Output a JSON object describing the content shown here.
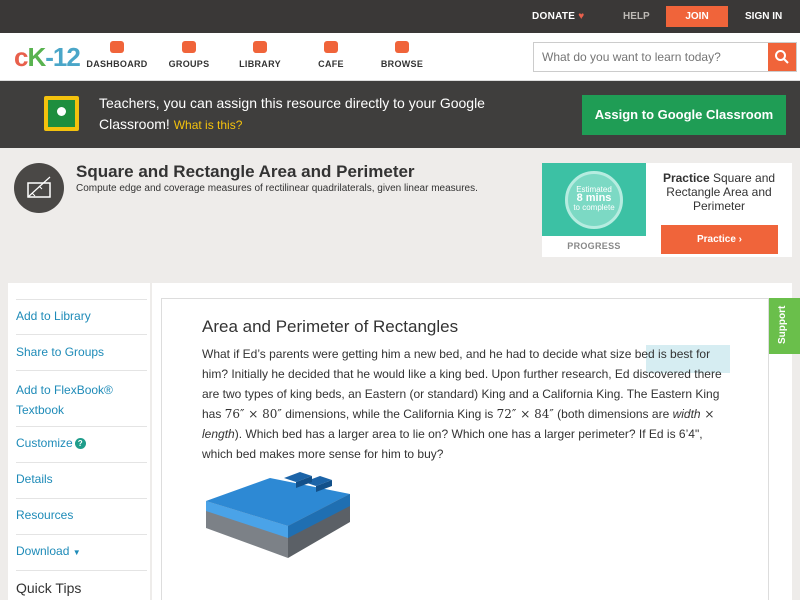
{
  "topbar": {
    "donate": "DONATE",
    "help": "HELP",
    "join": "JOIN",
    "signin": "SIGN IN"
  },
  "logo": {
    "c": "c",
    "k": "K",
    "n": "-12"
  },
  "nav": {
    "items": [
      {
        "label": "DASHBOARD",
        "icon": "dashboard-icon"
      },
      {
        "label": "GROUPS",
        "icon": "groups-icon"
      },
      {
        "label": "LIBRARY",
        "icon": "library-icon"
      },
      {
        "label": "CAFE",
        "icon": "cafe-icon"
      },
      {
        "label": "BROWSE",
        "icon": "browse-icon"
      }
    ],
    "search_placeholder": "What do you want to learn today?"
  },
  "classroom_banner": {
    "text": "Teachers, you can assign this resource directly to your Google Classroom!",
    "what": "What is this?",
    "button": "Assign to Google Classroom"
  },
  "concept": {
    "title": "Square and Rectangle Area and Perimeter",
    "subtitle": "Compute edge and coverage measures of rectilinear quadrilaterals, given linear measures."
  },
  "practice": {
    "estimated": "Estimated",
    "mins": "8 mins",
    "to_complete": "to complete",
    "progress_label": "PROGRESS",
    "title_bold": "Practice",
    "title_rest": "Square and Rectangle Area and Perimeter",
    "button": "Practice"
  },
  "sidebar": {
    "add_library": "Add to Library",
    "share_groups": "Share to Groups",
    "add_flexbook_1": "Add to FlexBook®",
    "add_flexbook_2": "Textbook",
    "customize": "Customize",
    "details": "Details",
    "resources": "Resources",
    "download": "Download",
    "quick_tips": "Quick Tips"
  },
  "content": {
    "title": "Area and Perimeter of Rectangles",
    "p1": "What if Ed’s parents were getting him a new bed, and he had to decide what size bed is best for him? Initially he decided that he would like a king bed. Upon further research, Ed discovered there are two types of king beds, an Eastern (or standard) King and a California King. The Eastern King has ",
    "m1": "76″ × 80″",
    "p2": " dimensions, while the California King is ",
    "m2": "72″ × 84″",
    "p3": " (both dimensions are ",
    "width": "width",
    "times": " × ",
    "length": "length",
    "p4": "). Which bed has a larger area to lie on? Which one has a larger perimeter? If Ed is 6’4\", which bed makes more sense for him to buy?"
  },
  "support": "Support",
  "colors": {
    "accent": "#f0643a",
    "green": "#1f9d55",
    "link": "#1e8bb8",
    "dark": "#3a3837"
  }
}
